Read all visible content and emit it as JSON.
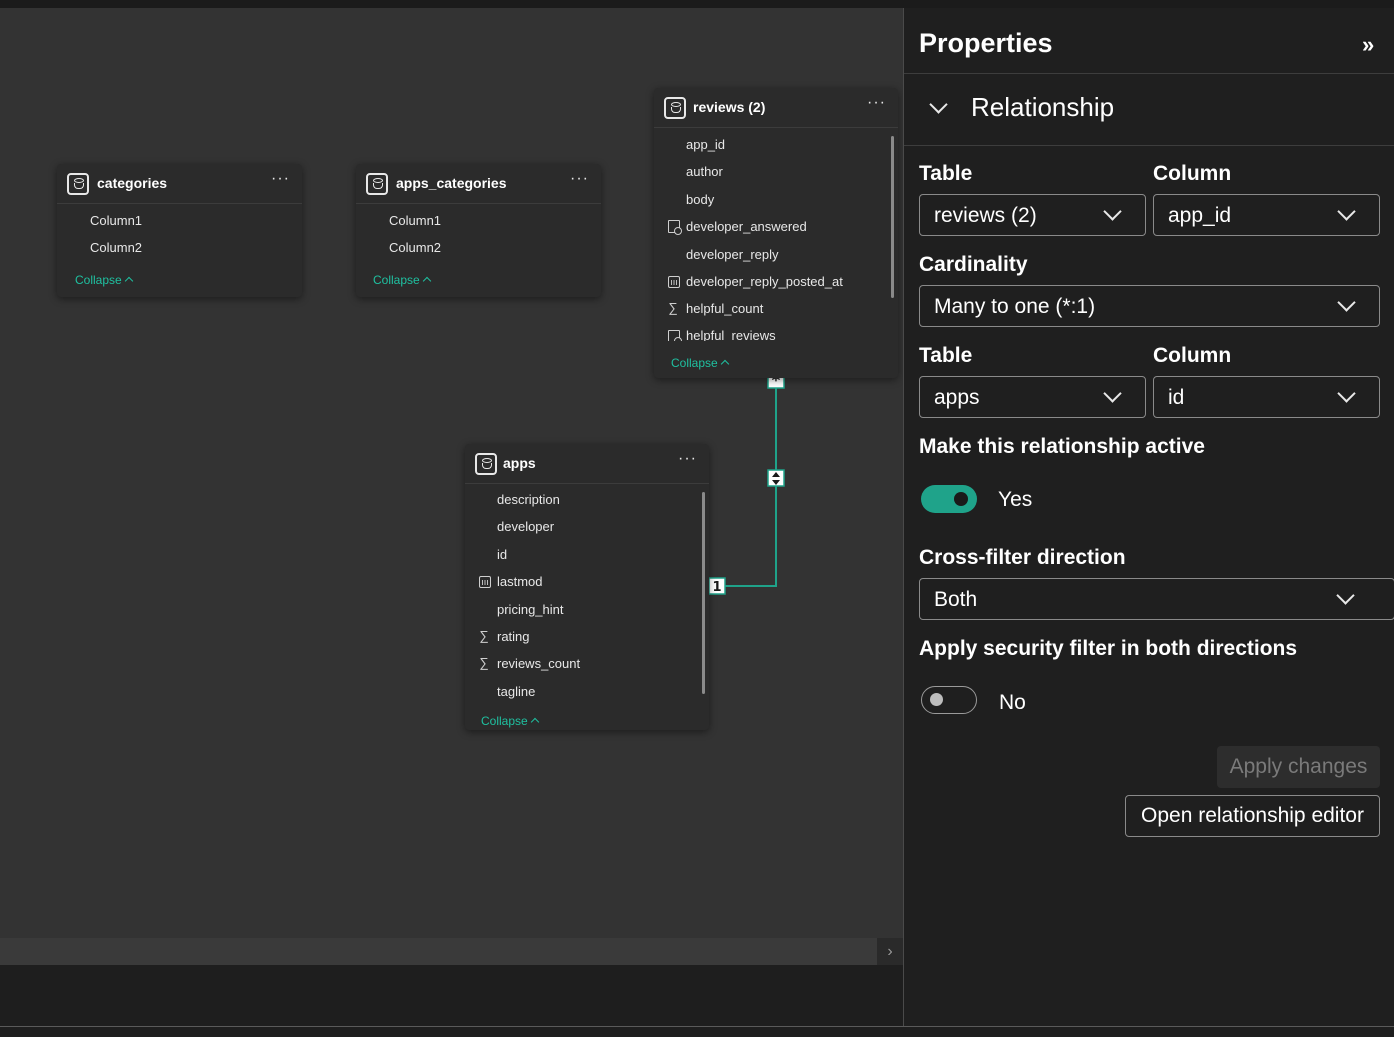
{
  "canvas": {
    "tables": {
      "categories": {
        "title": "categories",
        "more": "···",
        "columns": [
          "Column1",
          "Column2"
        ],
        "collapse": "Collapse"
      },
      "apps_categories": {
        "title": "apps_categories",
        "more": "···",
        "columns": [
          "Column1",
          "Column2"
        ],
        "collapse": "Collapse"
      },
      "reviews": {
        "title": "reviews (2)",
        "more": "···",
        "columns": [
          "app_id",
          "author",
          "body",
          "developer_answered",
          "developer_reply",
          "developer_reply_posted_at",
          "helpful_count",
          "helpful_reviews"
        ],
        "collapse": "Collapse"
      },
      "apps": {
        "title": "apps",
        "more": "···",
        "columns": [
          "description",
          "developer",
          "id",
          "lastmod",
          "pricing_hint",
          "rating",
          "reviews_count",
          "tagline"
        ],
        "collapse": "Collapse"
      }
    },
    "relationship": {
      "many_marker": "*",
      "one_marker": "1"
    }
  },
  "panel": {
    "title": "Properties",
    "collapse_icon": "»",
    "section": "Relationship",
    "table_label": "Table",
    "column_label": "Column",
    "from_table": "reviews (2)",
    "from_column": "app_id",
    "cardinality_label": "Cardinality",
    "cardinality": "Many to one (*:1)",
    "to_table_label": "Table",
    "to_column_label": "Column",
    "to_table": "apps",
    "to_column": "id",
    "active_label": "Make this relationship active",
    "active_value": "Yes",
    "crossfilter_label": "Cross-filter direction",
    "crossfilter": "Both",
    "security_label": "Apply security filter in both directions",
    "security_value": "No",
    "apply_button": "Apply changes",
    "open_editor_button": "Open relationship editor"
  },
  "colors": {
    "accent": "#1fa38a",
    "link": "#1fc0a0",
    "canvas": "#333333",
    "panel": "#1f1f1f"
  }
}
